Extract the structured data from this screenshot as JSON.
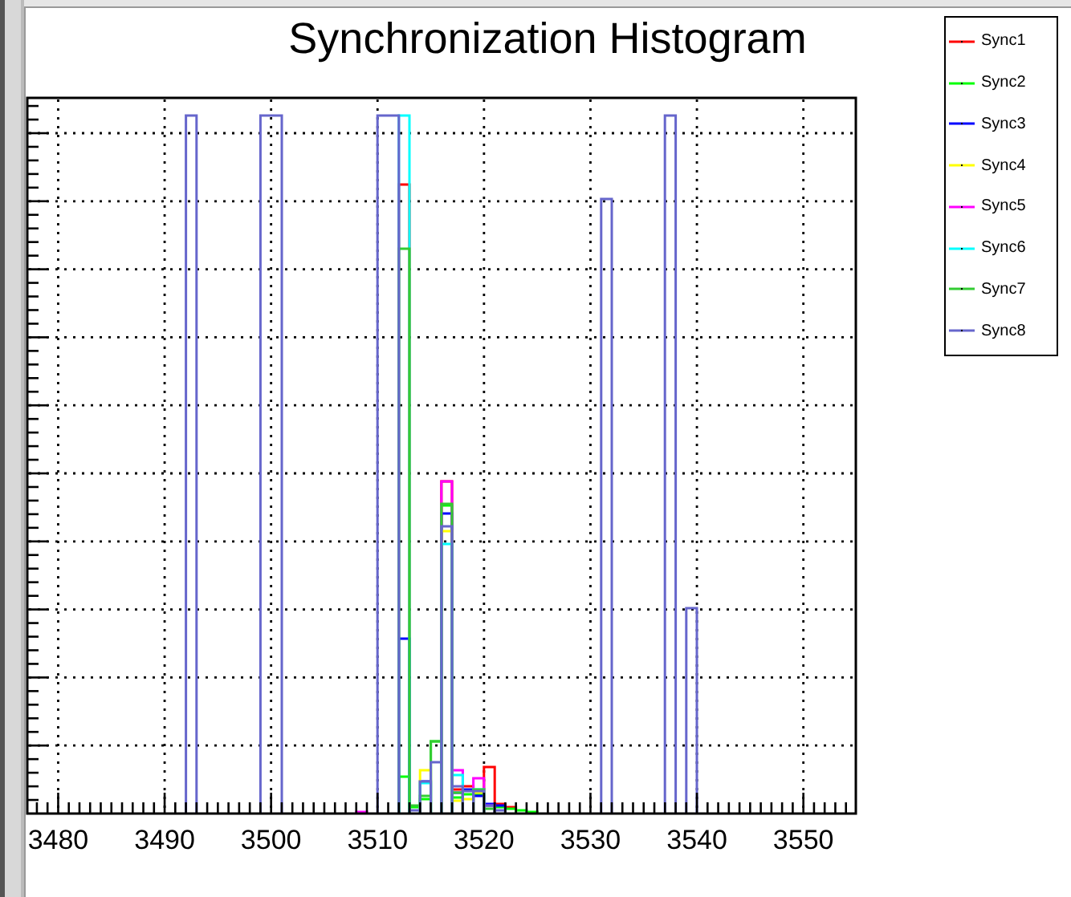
{
  "title": "Synchronization Histogram",
  "plot": {
    "x_tick_labels": [
      "3480",
      "3490",
      "3500",
      "3510",
      "3520",
      "3530",
      "3540",
      "3550"
    ]
  },
  "legend": {
    "entries": [
      {
        "label": "Sync1",
        "color": "#ff0000"
      },
      {
        "label": "Sync2",
        "color": "#00ff00"
      },
      {
        "label": "Sync3",
        "color": "#0000ff"
      },
      {
        "label": "Sync4",
        "color": "#ffff00"
      },
      {
        "label": "Sync5",
        "color": "#ff00ff"
      },
      {
        "label": "Sync6",
        "color": "#00ffff"
      },
      {
        "label": "Sync7",
        "color": "#33cc33"
      },
      {
        "label": "Sync8",
        "color": "#6666cc"
      }
    ]
  }
}
